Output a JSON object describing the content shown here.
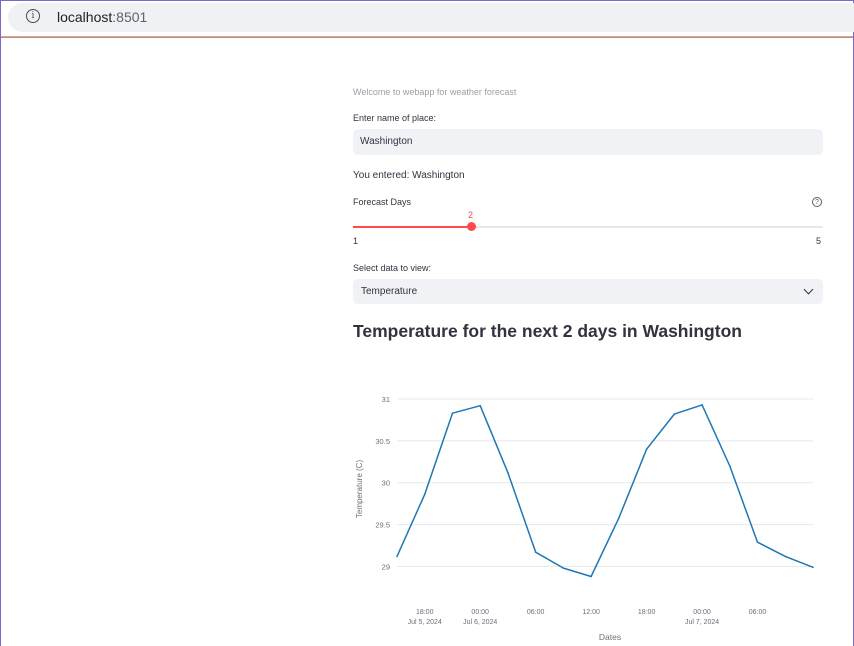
{
  "browser": {
    "url_host": "localhost",
    "url_port": ":8501"
  },
  "app": {
    "welcome_text": "Welcome to webapp for weather forecast",
    "place_label": "Enter name of place:",
    "place_value": "Washington",
    "entered_prefix": "You entered: ",
    "entered_value": "Washington",
    "days_label": "Forecast Days",
    "days_slider": {
      "min": 1,
      "max": 5,
      "value": 2,
      "min_label": "1",
      "max_label": "5",
      "value_label": "2"
    },
    "select_label": "Select data to view:",
    "select_value": "Temperature",
    "heading": "Temperature for the next 2 days in Washington"
  },
  "colors": {
    "accent": "#ff4b4b",
    "line": "#1f77b4",
    "input_bg": "#f0f2f6",
    "text": "#31333f"
  },
  "chart_data": {
    "type": "line",
    "xlabel": "Dates",
    "ylabel": "Temperature (C)",
    "ylim": [
      28.85,
      31.0
    ],
    "yticks": [
      29,
      29.5,
      30,
      30.5,
      31
    ],
    "ytick_labels": [
      "29",
      "29.5",
      "30",
      "30.5",
      "31"
    ],
    "xticks": [
      {
        "hour": 18,
        "line1": "18:00",
        "line2": "Jul 5, 2024"
      },
      {
        "hour": 24,
        "line1": "00:00",
        "line2": "Jul 6, 2024"
      },
      {
        "hour": 30,
        "line1": "06:00",
        "line2": ""
      },
      {
        "hour": 36,
        "line1": "12:00",
        "line2": ""
      },
      {
        "hour": 42,
        "line1": "18:00",
        "line2": ""
      },
      {
        "hour": 48,
        "line1": "00:00",
        "line2": "Jul 7, 2024"
      },
      {
        "hour": 54,
        "line1": "06:00",
        "line2": ""
      }
    ],
    "x_range_hours": [
      15,
      60
    ],
    "series": [
      {
        "x": [
          15,
          18,
          21,
          24,
          27,
          30,
          33,
          36,
          39,
          42,
          45,
          48,
          51,
          54,
          57,
          60
        ],
        "y": [
          29.12,
          29.86,
          30.83,
          30.92,
          30.12,
          29.17,
          28.98,
          28.88,
          29.58,
          30.4,
          30.82,
          30.93,
          30.2,
          29.29,
          29.12,
          28.99
        ]
      }
    ],
    "grid": true,
    "legend": "none"
  }
}
